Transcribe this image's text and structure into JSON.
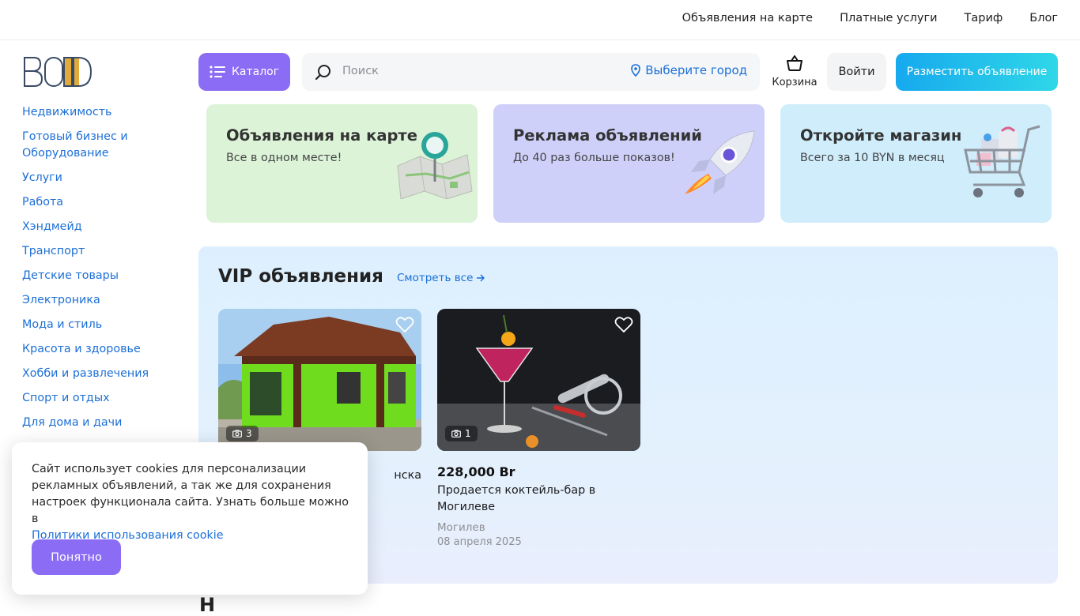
{
  "topnav": {
    "items": [
      "Объявления на карте",
      "Платные услуги",
      "Тариф",
      "Блог"
    ]
  },
  "header": {
    "catalog_label": "Каталог",
    "search_placeholder": "Поиск",
    "city_label": "Выберите город",
    "cart_label": "Корзина",
    "login_label": "Войти",
    "post_label": "Разместить объявление"
  },
  "sidebar": {
    "categories": [
      "Недвижимость",
      "Готовый бизнес и Оборудование",
      "Услуги",
      "Работа",
      "Хэндмейд",
      "Транспорт",
      "Детские товары",
      "Электроника",
      "Мода и стиль",
      "Красота и здоровье",
      "Хобби и развлечения",
      "Спорт и отдых",
      "Для дома и дачи"
    ]
  },
  "promos": [
    {
      "title": "Объявления на карте",
      "subtitle": "Все в одном месте!",
      "bg": "#dcf3d8"
    },
    {
      "title": "Реклама объявлений",
      "subtitle": "До 40 раз больше показов!",
      "bg": "#cfd0fa"
    },
    {
      "title": "Откройте магазин",
      "subtitle": "Всего за 10 BYN в месяц",
      "bg": "#cfedfb"
    }
  ],
  "vip": {
    "title": "VIP объявления",
    "see_all": "Смотреть все",
    "cards": [
      {
        "photo_count": "3",
        "price": "",
        "title": "нска",
        "city": "",
        "date": ""
      },
      {
        "photo_count": "1",
        "price": "228,000 Br",
        "title": "Продается коктейль-бар в Могилеве",
        "city": "Могилев",
        "date": "08 апреля 2025"
      }
    ]
  },
  "cookie": {
    "text": "Сайт использует cookies для персонализации рекламных объявлений, а так же для сохранения настроек функционала сайта. Узнать больше можно в",
    "link": "Политики использования cookie",
    "ok_label": "Понятно"
  },
  "colors": {
    "accent": "#8b6cf5",
    "link": "#1a6fd8",
    "post_gradient_start": "#16a9ee",
    "post_gradient_end": "#2fd7e8"
  }
}
